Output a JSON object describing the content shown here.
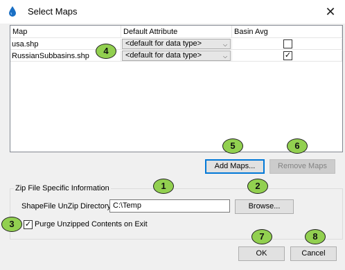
{
  "window": {
    "title": "Select Maps",
    "close_glyph": "✕"
  },
  "table": {
    "columns": [
      "Map",
      "Default Attribute",
      "Basin Avg"
    ],
    "rows": [
      {
        "map": "usa.shp",
        "attribute": "<default for data type>",
        "basin_avg": false
      },
      {
        "map": "RussianSubbasins.shp",
        "attribute": "<default for data type>",
        "basin_avg": true
      }
    ]
  },
  "buttons": {
    "add_maps": "Add Maps...",
    "remove_maps": "Remove Maps",
    "browse": "Browse...",
    "ok": "OK",
    "cancel": "Cancel"
  },
  "zip": {
    "group_label": "Zip File Specific Information",
    "dir_label": "ShapeFile UnZip Directory:",
    "dir_value": "C:\\Temp",
    "purge_label": "Purge Unzipped Contents on Exit",
    "purge_checked": true
  },
  "callouts": [
    "1",
    "2",
    "3",
    "4",
    "5",
    "6",
    "7",
    "8"
  ],
  "colors": {
    "callout_fill": "#92d050",
    "focus_border": "#0078d7",
    "app_icon": "#1a6fc4"
  },
  "icons": {
    "app": "water-drop-icon",
    "combo_arrow": "chevron-down-icon"
  }
}
